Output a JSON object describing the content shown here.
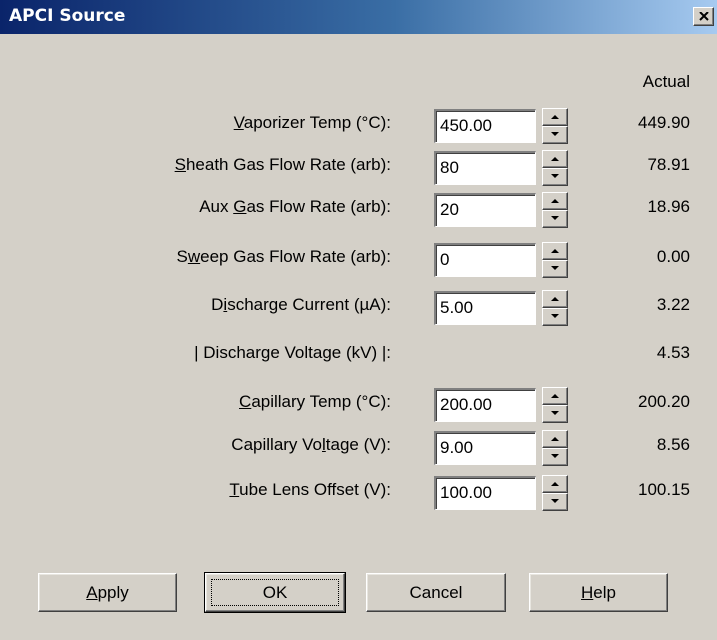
{
  "window": {
    "title": "APCI Source",
    "close_glyph": "×"
  },
  "actual_header": "Actual",
  "rows": [
    {
      "pre": "",
      "ul": "V",
      "post": "aporizer Temp (°C):",
      "value": "450.00",
      "actual": "449.90",
      "editable": true
    },
    {
      "pre": "",
      "ul": "S",
      "post": "heath Gas Flow Rate (arb):",
      "value": "80",
      "actual": "78.91",
      "editable": true
    },
    {
      "pre": "Aux ",
      "ul": "G",
      "post": "as Flow Rate (arb):",
      "value": "20",
      "actual": "18.96",
      "editable": true
    },
    {
      "pre": "S",
      "ul": "w",
      "post": "eep Gas Flow Rate (arb):",
      "value": "0",
      "actual": "0.00",
      "editable": true
    },
    {
      "pre": "D",
      "ul": "i",
      "post": "scharge Current (µA):",
      "value": "5.00",
      "actual": "3.22",
      "editable": true
    },
    {
      "pre": "| Discharge Voltage (kV) |:",
      "ul": "",
      "post": "",
      "value": "",
      "actual": "4.53",
      "editable": false
    },
    {
      "pre": "",
      "ul": "C",
      "post": "apillary Temp (°C):",
      "value": "200.00",
      "actual": "200.20",
      "editable": true
    },
    {
      "pre": "Capillary Vo",
      "ul": "l",
      "post": "tage (V):",
      "value": "9.00",
      "actual": "8.56",
      "editable": true
    },
    {
      "pre": "",
      "ul": "T",
      "post": "ube Lens Offset (V):",
      "value": "100.00",
      "actual": "100.15",
      "editable": true
    }
  ],
  "buttons": {
    "apply": {
      "ul": "A",
      "post": "pply"
    },
    "ok": {
      "label": "OK"
    },
    "cancel": {
      "label": "Cancel"
    },
    "help": {
      "ul": "H",
      "post": "elp"
    }
  },
  "colors": {
    "titlebar_start": "#0a246a",
    "titlebar_end": "#a6caf0",
    "dialog_bg": "#d4d0c8"
  }
}
